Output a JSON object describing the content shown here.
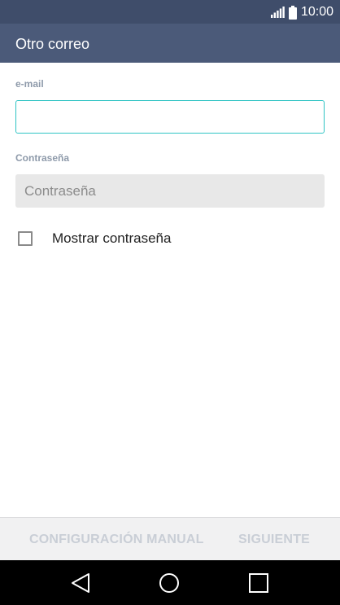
{
  "status_bar": {
    "time": "10:00",
    "icons": [
      "signal-icon",
      "battery-icon"
    ]
  },
  "app_bar": {
    "title": "Otro correo"
  },
  "form": {
    "email": {
      "label": "e-mail",
      "value": "",
      "placeholder": ""
    },
    "password": {
      "label": "Contraseña",
      "value": "",
      "placeholder": "Contraseña"
    },
    "show_password": {
      "label": "Mostrar contraseña",
      "checked": false
    }
  },
  "actions": {
    "manual_config_label": "CONFIGURACIÓN MANUAL",
    "next_label": "SIGUIENTE"
  },
  "navigation": {
    "buttons": [
      "back-icon",
      "home-icon",
      "recent-apps-icon"
    ]
  },
  "colors": {
    "status_bar": "#3f4d6a",
    "app_bar": "#4b5a79",
    "input_focus_border": "#2fc4c4",
    "disabled_action_text": "#c9ced6"
  }
}
